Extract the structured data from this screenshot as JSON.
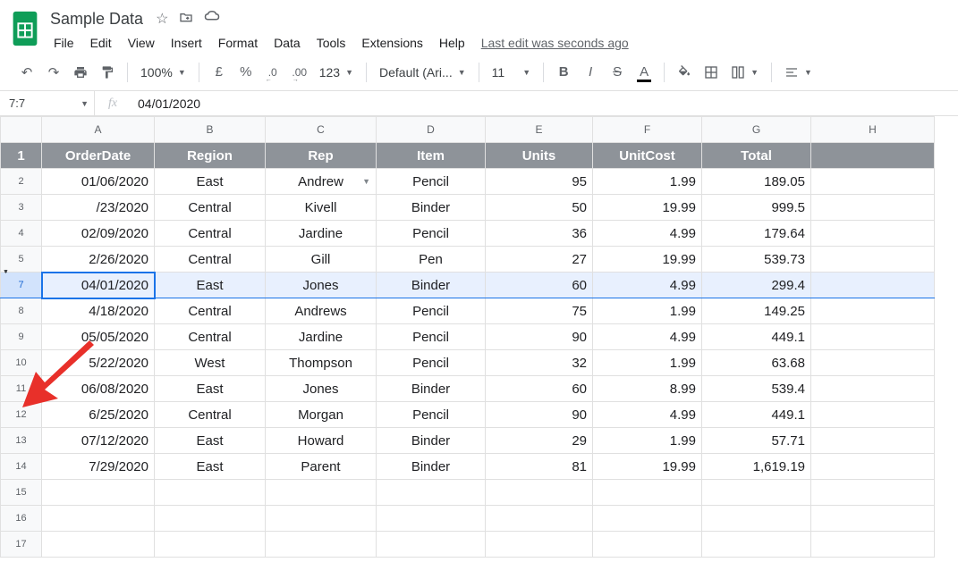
{
  "title": "Sample Data",
  "menubar": [
    "File",
    "Edit",
    "View",
    "Insert",
    "Format",
    "Data",
    "Tools",
    "Extensions",
    "Help"
  ],
  "last_edit": "Last edit was seconds ago",
  "toolbar": {
    "zoom": "100%",
    "currency": "£",
    "percent": "%",
    "dec_dec": ".0",
    "inc_dec": ".00",
    "more_fmt": "123",
    "font": "Default (Ari...",
    "font_size": "11"
  },
  "name_box": "7:7",
  "formula": "04/01/2020",
  "columns": [
    "A",
    "B",
    "C",
    "D",
    "E",
    "F",
    "G",
    "H"
  ],
  "headers": [
    "OrderDate",
    "Region",
    "Rep",
    "Item",
    "Units",
    "UnitCost",
    "Total"
  ],
  "row_numbers": [
    1,
    2,
    3,
    4,
    5,
    7,
    8,
    9,
    10,
    11,
    12,
    13,
    14,
    15,
    16,
    17
  ],
  "rows": [
    {
      "n": 2,
      "d": [
        "01/06/2020",
        "East",
        "Andrew",
        "Pencil",
        "95",
        "1.99",
        "189.05"
      ],
      "dd": true
    },
    {
      "n": 3,
      "d": [
        "/23/2020",
        "Central",
        "Kivell",
        "Binder",
        "50",
        "19.99",
        "999.5"
      ]
    },
    {
      "n": 4,
      "d": [
        "02/09/2020",
        "Central",
        "Jardine",
        "Pencil",
        "36",
        "4.99",
        "179.64"
      ]
    },
    {
      "n": 5,
      "d": [
        "2/26/2020",
        "Central",
        "Gill",
        "Pen",
        "27",
        "19.99",
        "539.73"
      ]
    },
    {
      "n": 7,
      "d": [
        "04/01/2020",
        "East",
        "Jones",
        "Binder",
        "60",
        "4.99",
        "299.4"
      ],
      "sel": true
    },
    {
      "n": 8,
      "d": [
        "4/18/2020",
        "Central",
        "Andrews",
        "Pencil",
        "75",
        "1.99",
        "149.25"
      ]
    },
    {
      "n": 9,
      "d": [
        "05/05/2020",
        "Central",
        "Jardine",
        "Pencil",
        "90",
        "4.99",
        "449.1"
      ]
    },
    {
      "n": 10,
      "d": [
        "5/22/2020",
        "West",
        "Thompson",
        "Pencil",
        "32",
        "1.99",
        "63.68"
      ]
    },
    {
      "n": 11,
      "d": [
        "06/08/2020",
        "East",
        "Jones",
        "Binder",
        "60",
        "8.99",
        "539.4"
      ]
    },
    {
      "n": 12,
      "d": [
        "6/25/2020",
        "Central",
        "Morgan",
        "Pencil",
        "90",
        "4.99",
        "449.1"
      ]
    },
    {
      "n": 13,
      "d": [
        "07/12/2020",
        "East",
        "Howard",
        "Binder",
        "29",
        "1.99",
        "57.71"
      ]
    },
    {
      "n": 14,
      "d": [
        "7/29/2020",
        "East",
        "Parent",
        "Binder",
        "81",
        "19.99",
        "1,619.19"
      ]
    }
  ],
  "empty_rows": [
    15,
    16,
    17
  ]
}
